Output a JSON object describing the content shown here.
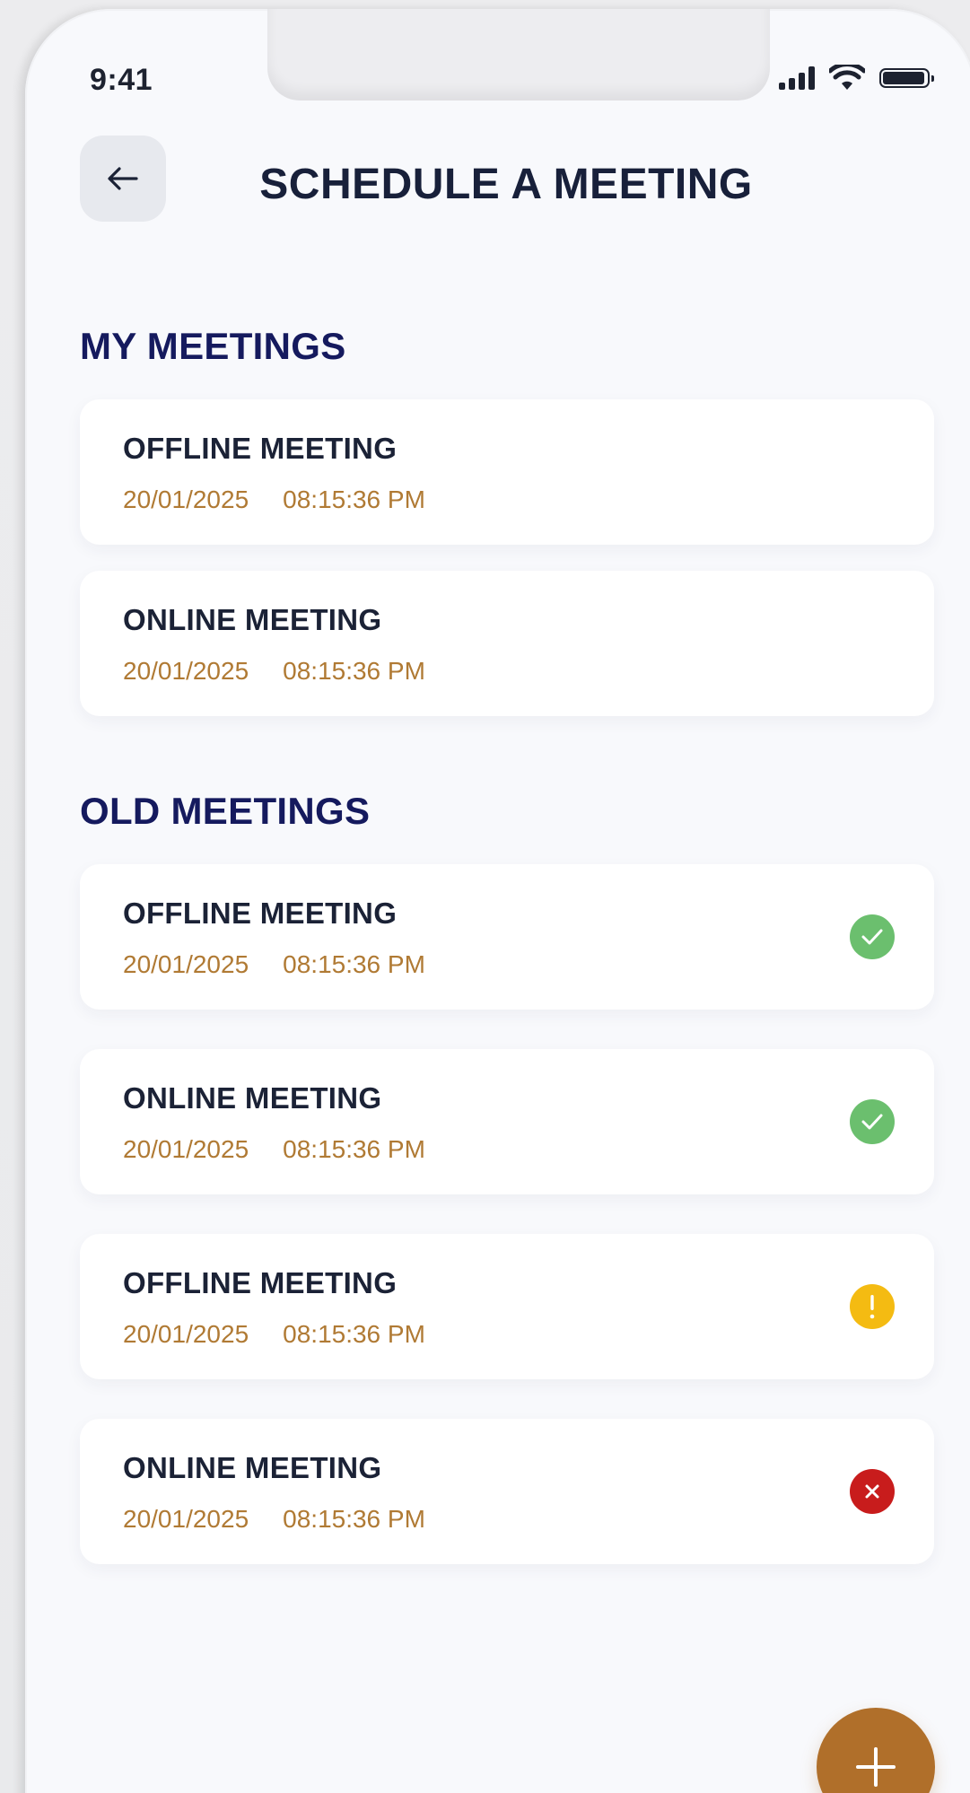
{
  "status_bar": {
    "time": "9:41",
    "icons": [
      "signal-icon",
      "wifi-icon",
      "battery-icon"
    ]
  },
  "header": {
    "back_icon": "arrow-left-icon",
    "title": "SCHEDULE A MEETING"
  },
  "my_meetings": {
    "title": "MY MEETINGS",
    "items": [
      {
        "title": "OFFLINE MEETING",
        "date": "20/01/2025",
        "time": "08:15:36 PM"
      },
      {
        "title": "ONLINE MEETING",
        "date": "20/01/2025",
        "time": "08:15:36 PM"
      }
    ]
  },
  "old_meetings": {
    "title": "OLD MEETINGS",
    "items": [
      {
        "title": "OFFLINE MEETING",
        "date": "20/01/2025",
        "time": "08:15:36 PM",
        "status_icon": "check-circle-icon",
        "status_color": "#6bbf6e"
      },
      {
        "title": "ONLINE MEETING",
        "date": "20/01/2025",
        "time": "08:15:36 PM",
        "status_icon": "check-circle-icon",
        "status_color": "#6bbf6e"
      },
      {
        "title": "OFFLINE MEETING",
        "date": "20/01/2025",
        "time": "08:15:36 PM",
        "status_icon": "exclamation-circle-icon",
        "status_color": "#f4bb12"
      },
      {
        "title": "ONLINE MEETING",
        "date": "20/01/2025",
        "time": "08:15:36 PM",
        "status_icon": "x-circle-icon",
        "status_color": "#c81c1c"
      }
    ]
  },
  "fab": {
    "icon": "plus-icon",
    "color": "#b06f2a"
  },
  "colors": {
    "title_navy": "#18203a",
    "section_navy": "#151a5e",
    "meta_gold": "#b07a34",
    "background": "#f8f9fc"
  }
}
